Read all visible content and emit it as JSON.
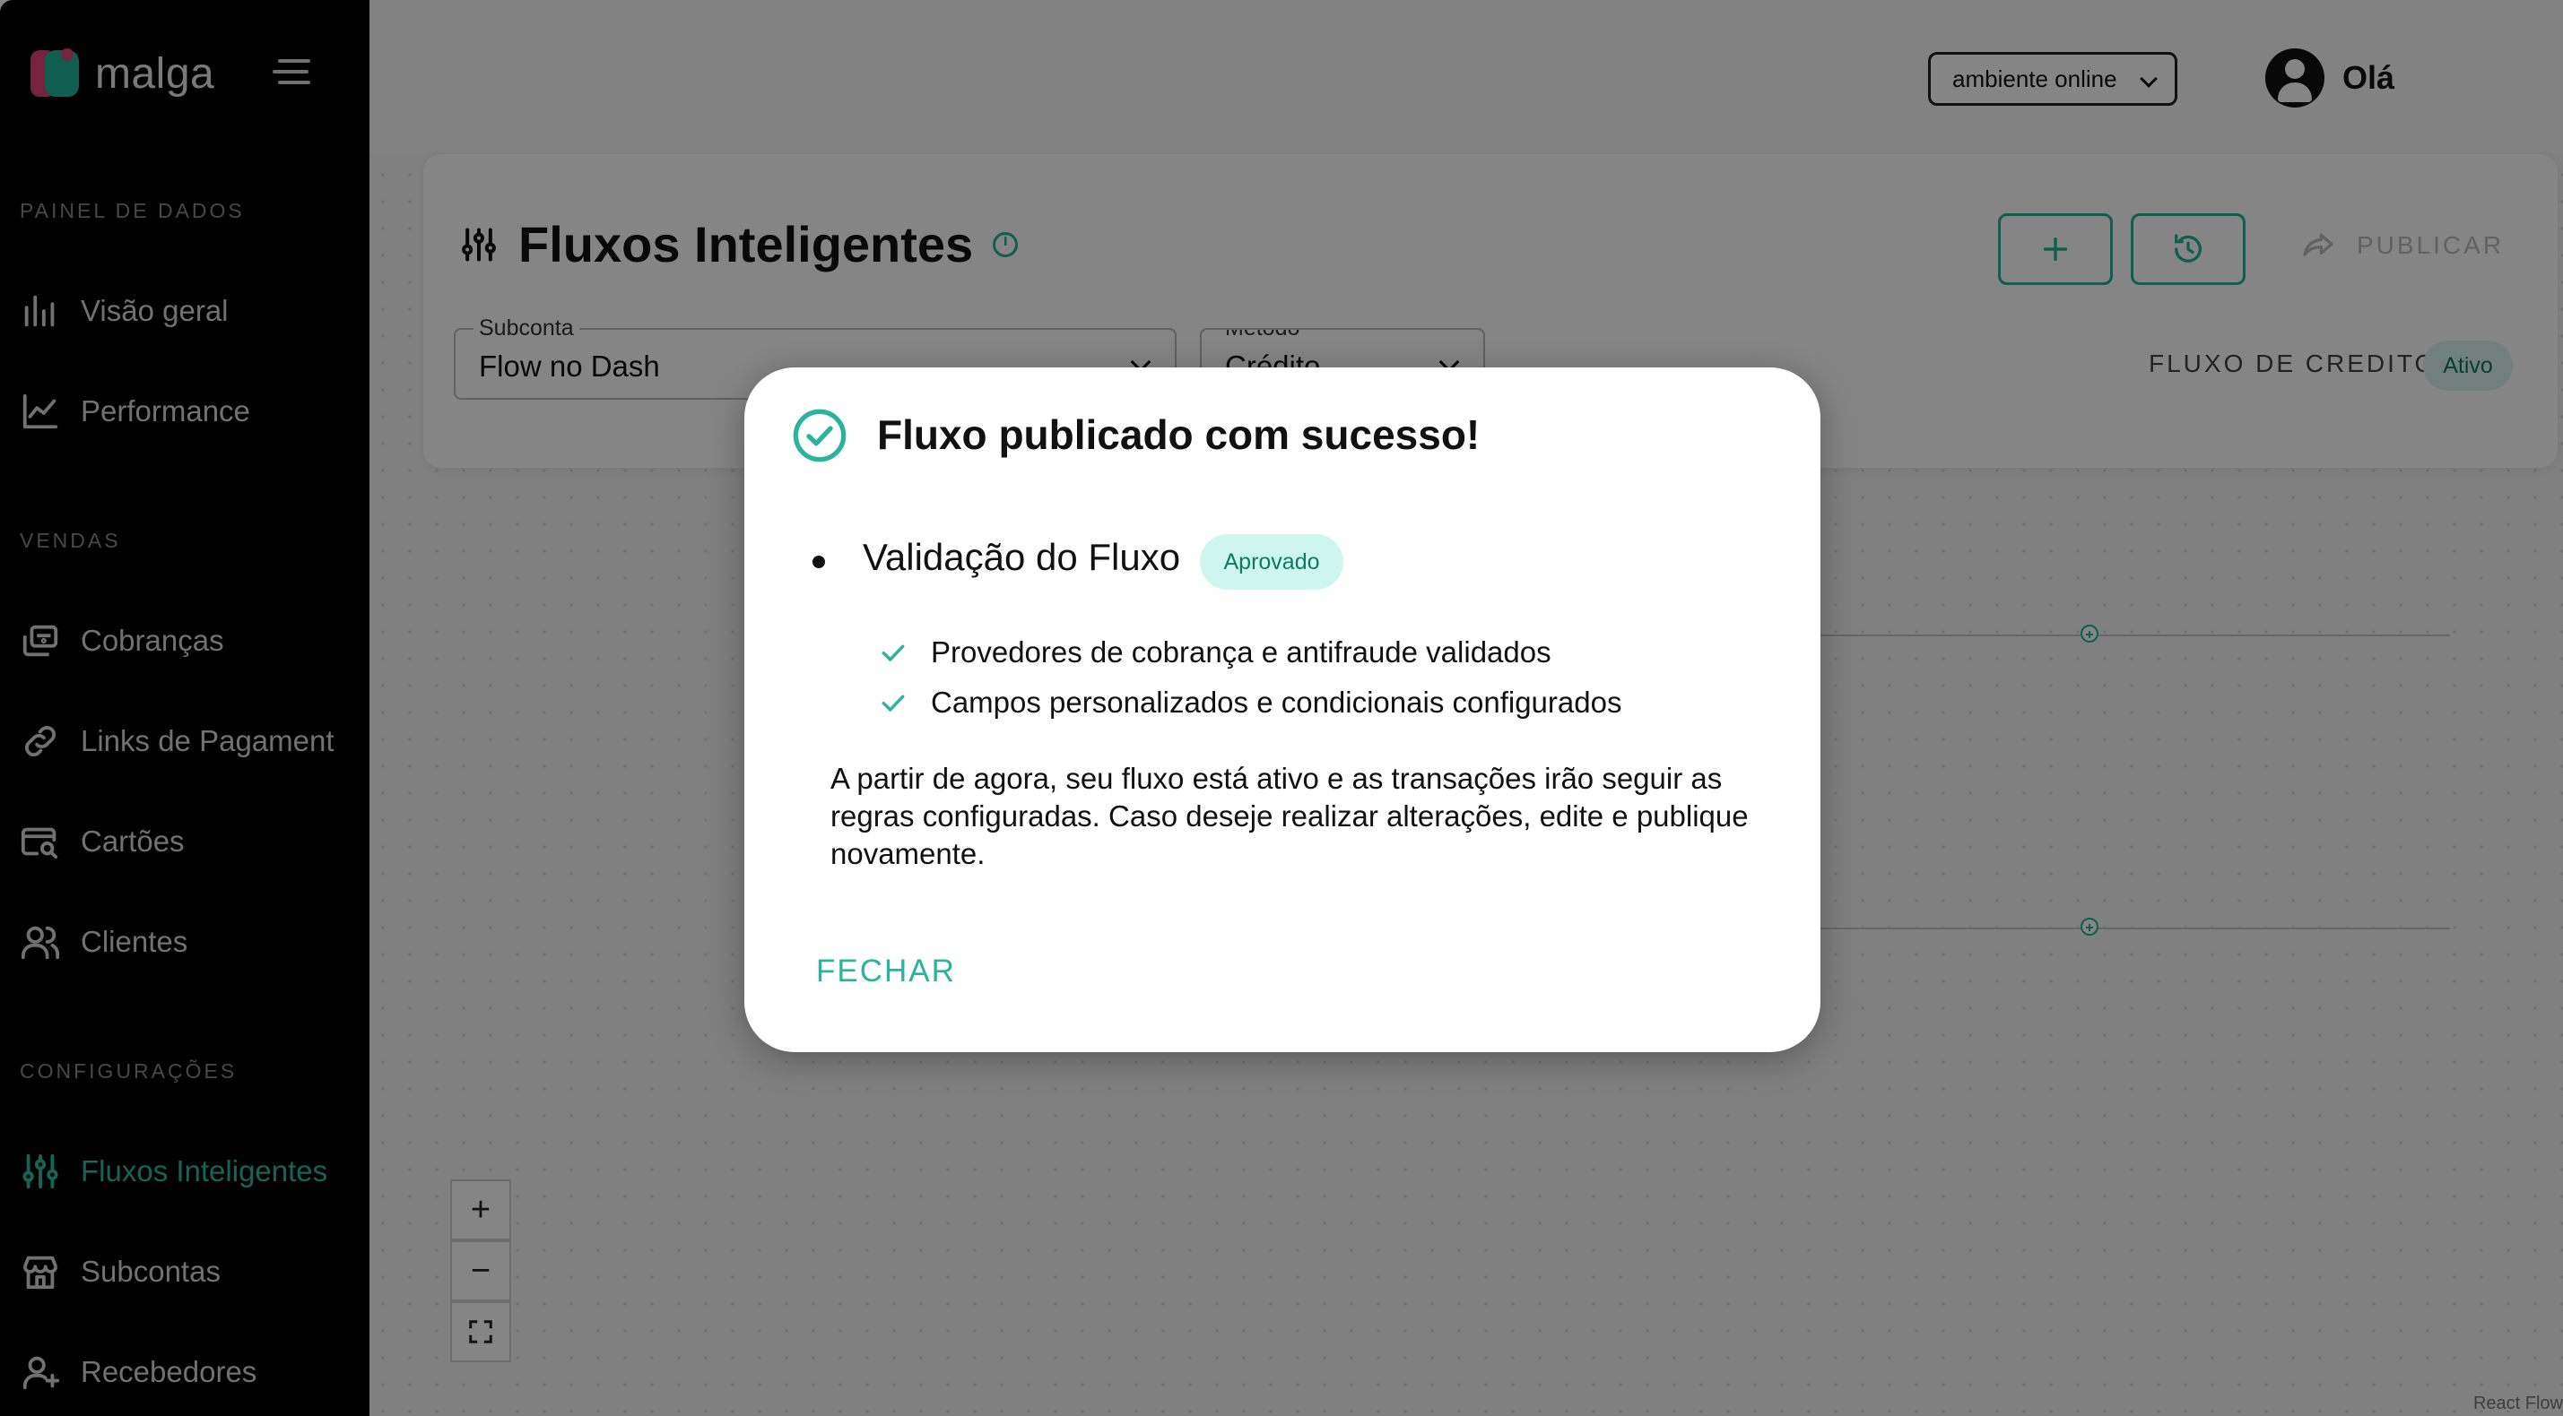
{
  "brand": {
    "name": "malga"
  },
  "sidebar": {
    "sections": [
      {
        "label": "PAINEL DE DADOS"
      },
      {
        "label": "VENDAS"
      },
      {
        "label": "CONFIGURAÇÕES"
      }
    ],
    "items": [
      {
        "label": "Visão geral",
        "icon": "bar-chart-icon"
      },
      {
        "label": "Performance",
        "icon": "line-chart-icon"
      },
      {
        "label": "Cobranças",
        "icon": "charges-icon"
      },
      {
        "label": "Links de Pagament",
        "icon": "link-icon"
      },
      {
        "label": "Cartões",
        "icon": "card-search-icon"
      },
      {
        "label": "Clientes",
        "icon": "users-icon"
      },
      {
        "label": "Fluxos Inteligentes",
        "icon": "sliders-icon",
        "active": true
      },
      {
        "label": "Subcontas",
        "icon": "store-icon"
      },
      {
        "label": "Recebedores",
        "icon": "user-plus-icon"
      }
    ]
  },
  "header": {
    "environment": "ambiente online",
    "greeting": "Olá"
  },
  "page": {
    "title": "Fluxos Inteligentes",
    "publish_label": "PUBLICAR",
    "subconta": {
      "label": "Subconta",
      "value": "Flow no Dash"
    },
    "metodo": {
      "label": "Método",
      "value": "Crédito"
    },
    "flow_name": "FLUXO DE CREDITO",
    "flow_status": "Ativo"
  },
  "canvas": {
    "zoom_in": "+",
    "zoom_out": "−",
    "watermark": "React Flow"
  },
  "modal": {
    "title": "Fluxo publicado com sucesso!",
    "validation_title": "Validação do Fluxo",
    "validation_status": "Aprovado",
    "checks": [
      "Provedores de cobrança e antifraude validados",
      "Campos personalizados e condicionais configurados"
    ],
    "description": "A partir de agora, seu fluxo está ativo e as transações irão seguir as regras configuradas. Caso deseje realizar alterações, edite e publique novamente.",
    "close_label": "FECHAR"
  },
  "colors": {
    "accent": "#1fb59a",
    "accent_text": "#2bb49b",
    "sidebar_bg": "#000000",
    "badge_bg": "#cff6ee",
    "brand_pink": "#e0457b"
  }
}
